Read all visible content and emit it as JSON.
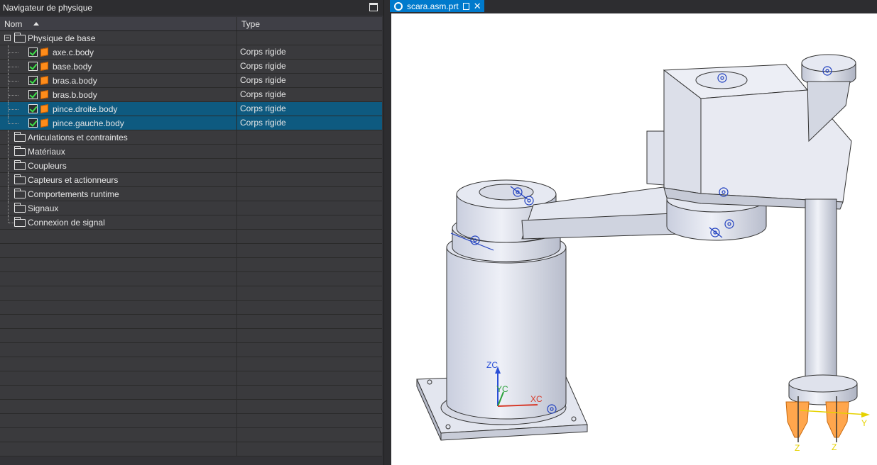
{
  "navigator": {
    "title": "Navigateur de physique",
    "columns": {
      "name": "Nom",
      "type": "Type"
    },
    "base_group": "Physique de base",
    "bodies": [
      {
        "name": "axe.c.body",
        "type": "Corps rigide",
        "selected": false
      },
      {
        "name": "base.body",
        "type": "Corps rigide",
        "selected": false
      },
      {
        "name": "bras.a.body",
        "type": "Corps rigide",
        "selected": false
      },
      {
        "name": "bras.b.body",
        "type": "Corps rigide",
        "selected": false
      },
      {
        "name": "pince.droite.body",
        "type": "Corps rigide",
        "selected": true
      },
      {
        "name": "pince.gauche.body",
        "type": "Corps rigide",
        "selected": true
      }
    ],
    "groups": [
      "Articulations et contraintes",
      "Matériaux",
      "Coupleurs",
      "Capteurs et actionneurs",
      "Comportements runtime",
      "Signaux",
      "Connexion de signal"
    ]
  },
  "document_tab": {
    "title": "scara.asm.prt",
    "close_label": "✕"
  },
  "triad": {
    "z": "ZC",
    "y": "YC",
    "x": "XC"
  },
  "gripper_axes": {
    "y": "Y",
    "z_left": "Z",
    "z_right": "Z"
  },
  "colors": {
    "selection": "#0e5a80",
    "tab_accent": "#007acc",
    "checkbox_green": "#3ee04a",
    "body_orange": "#ff8c1a",
    "model_fill": "#dfe3ef",
    "gripper_orange": "#ffa64d"
  },
  "icons": [
    "maximize-icon",
    "folder-icon",
    "checkbox-icon",
    "rigid-body-icon",
    "part-file-icon",
    "pin-icon",
    "close-icon"
  ]
}
